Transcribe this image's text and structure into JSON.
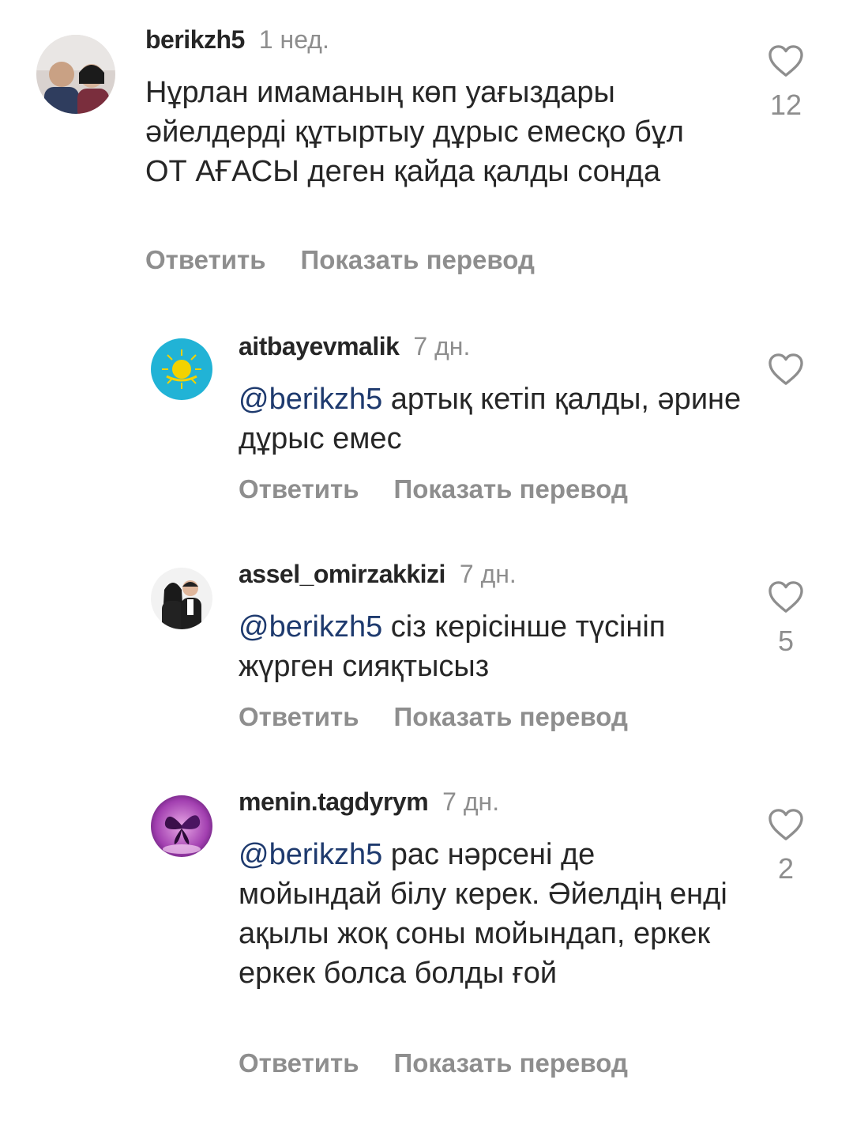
{
  "comments": [
    {
      "username": "berikzh5",
      "time": "1 нед.",
      "text": "Нұрлан имаманың көп уағыздары әйелдерді құтыртыу дұрыс емесқо бұл  ОТ АҒАСЫ деген қайда қалды сонда",
      "mention": "",
      "reply_label": "Ответить",
      "translate_label": "Показать перевод",
      "likes": "12"
    },
    {
      "username": "aitbayevmalik",
      "time": "7 дн.",
      "mention": "@berikzh5",
      "text": " артық кетіп қалды, әрине дұрыс емес",
      "reply_label": "Ответить",
      "translate_label": "Показать перевод",
      "likes": ""
    },
    {
      "username": "assel_omirzakkizi",
      "time": "7 дн.",
      "mention": "@berikzh5",
      "text": " сіз керісінше түсініп жүрген сияқтысыз",
      "reply_label": "Ответить",
      "translate_label": "Показать перевод",
      "likes": "5"
    },
    {
      "username": "menin.tagdyrym",
      "time": "7 дн.",
      "mention": "@berikzh5",
      "text": " рас нәрсені де мойындай білу керек. Әйелдің енді ақылы жоқ соны мойындап, еркек еркек болса болды ғой",
      "reply_label": "Ответить",
      "translate_label": "Показать перевод",
      "likes": "2"
    }
  ],
  "icons": {
    "like": "heart-outline-icon"
  },
  "colors": {
    "mention": "#1e3a6e",
    "muted": "#8e8e8e",
    "text": "#262626"
  }
}
